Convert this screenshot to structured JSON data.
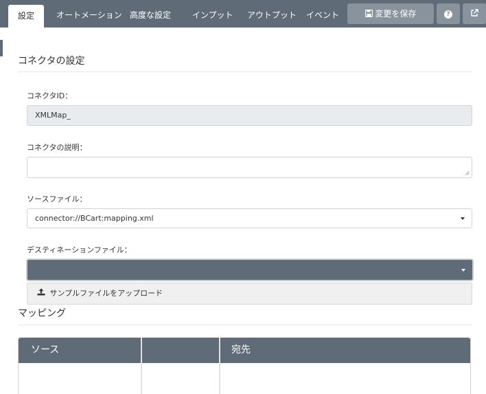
{
  "tabs": [
    {
      "label": "設定",
      "active": true
    },
    {
      "label": "オートメーション",
      "active": false
    },
    {
      "label": "高度な設定",
      "active": false
    },
    {
      "label": "インプット",
      "active": false
    },
    {
      "label": "アウトプット",
      "active": false
    },
    {
      "label": "イベント",
      "active": false
    }
  ],
  "toolbar": {
    "save_label": "変更を保存",
    "save_icon": "save-icon",
    "help_icon": "help-icon",
    "help_glyph": "?",
    "external_icon": "external-link-icon"
  },
  "section": {
    "title": "コネクタの設定"
  },
  "fields": {
    "connector_id_label": "コネクタID：",
    "connector_id_value": "XMLMap_",
    "description_label": "コネクタの説明：",
    "description_value": "",
    "source_label": "ソースファイル：",
    "source_value": "connector://BCart:mapping.xml",
    "destination_label": "デスティネーションファイル：",
    "destination_value": ""
  },
  "dropdown": {
    "upload_label": "サンプルファイルをアップロード",
    "upload_icon": "upload-icon"
  },
  "mapping": {
    "title": "マッピング",
    "columns": [
      "ソース",
      "",
      "宛先"
    ]
  },
  "colors": {
    "header_bg": "#5f6b77",
    "button_bg": "#88939e",
    "readonly_bg": "#e9ecef"
  }
}
